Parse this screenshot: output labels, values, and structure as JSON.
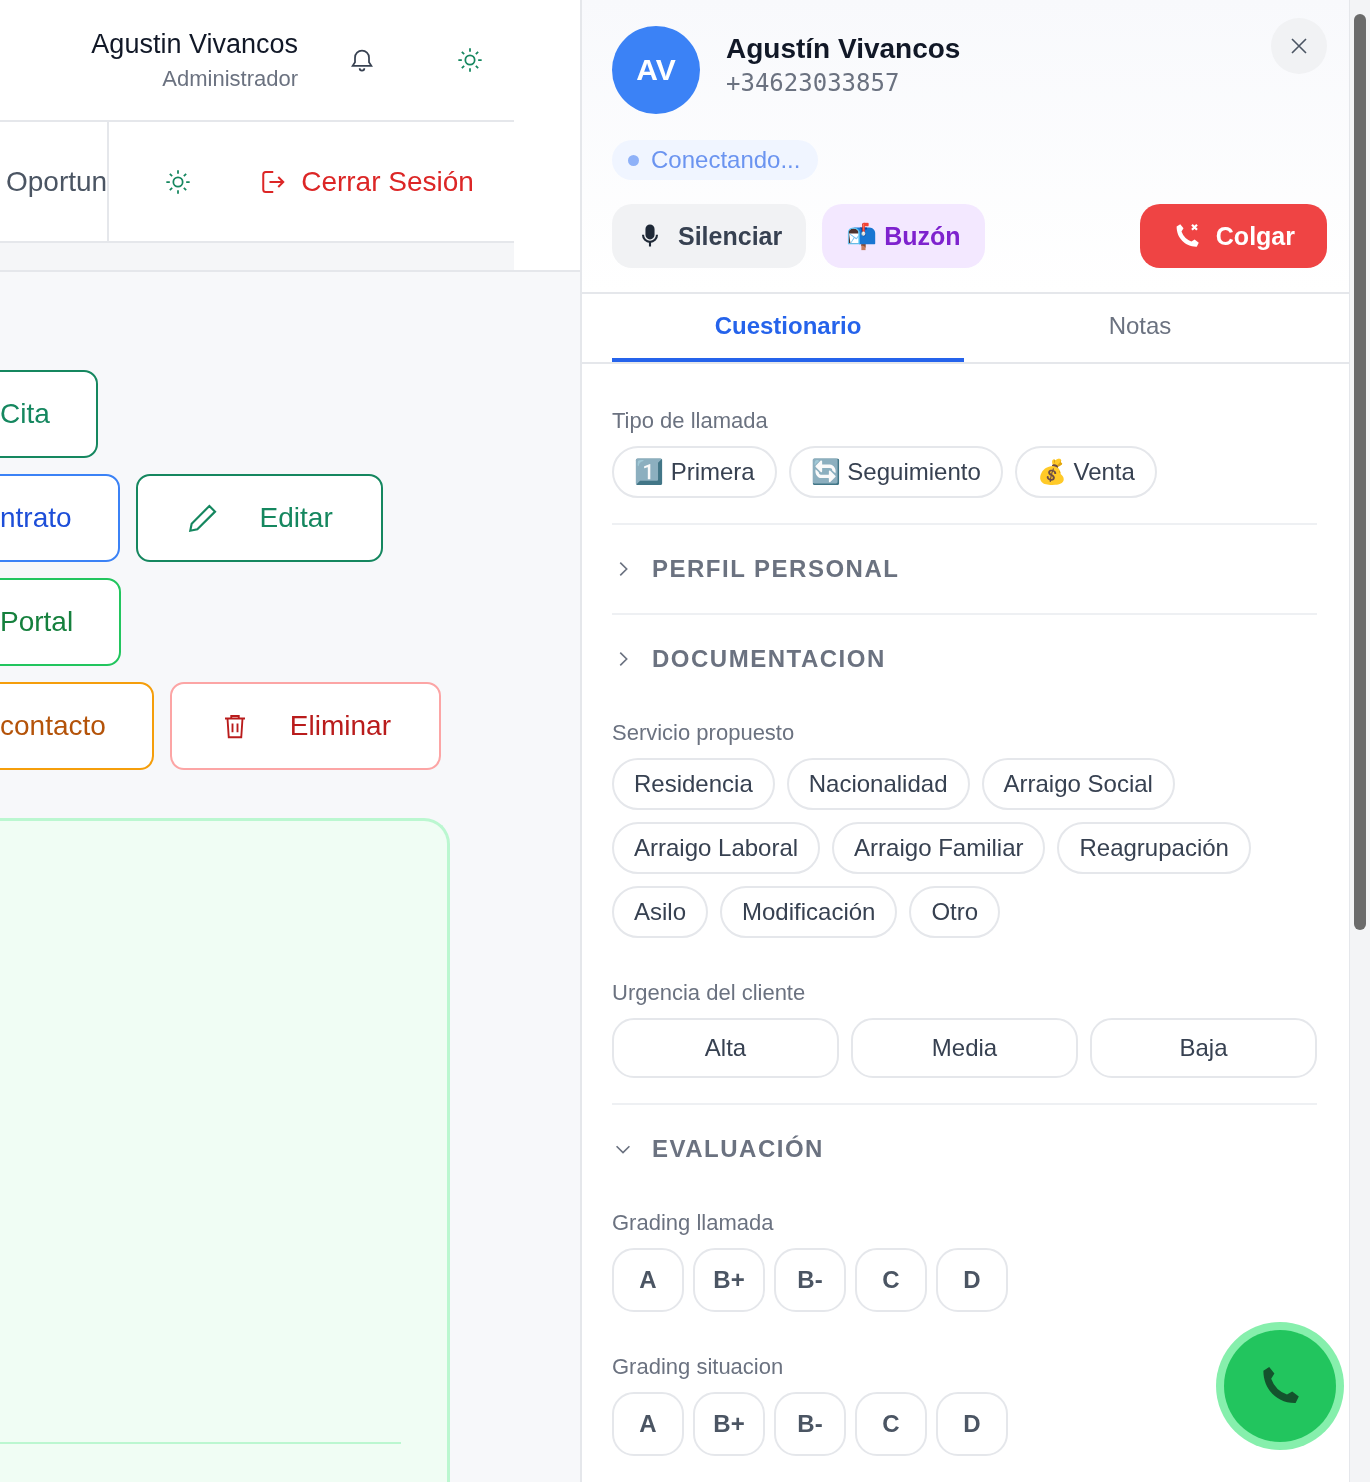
{
  "topbar": {
    "user_name": "Agustin Vivancos",
    "user_role": "Administrador"
  },
  "nav": {
    "items": [
      {
        "label": "Oportun"
      }
    ],
    "logout": "Cerrar Sesión"
  },
  "actions": [
    {
      "buttons": [
        {
          "label": "Cita",
          "kind": "cut",
          "color": "#15875f"
        }
      ]
    },
    {
      "buttons": [
        {
          "label": "ntrato",
          "kind": "cut",
          "color": "#3b82f6"
        },
        {
          "label": "Editar",
          "kind": "pencil",
          "color": "#15875f"
        }
      ]
    },
    {
      "buttons": [
        {
          "label": "Portal",
          "kind": "cut",
          "color": "#22c55e"
        }
      ]
    },
    {
      "buttons": [
        {
          "label": "contacto",
          "kind": "cut",
          "color": "#f59e0b"
        },
        {
          "label": "Eliminar",
          "kind": "trash",
          "color": "#fca5a5"
        }
      ]
    }
  ],
  "call": {
    "initials": "AV",
    "name": "Agustín Vivancos",
    "phone": "+34623033857",
    "status": "Conectando...",
    "controls": [
      {
        "kind": "mute",
        "label": "Silenciar"
      },
      {
        "kind": "voicemail",
        "emoji": "📬",
        "label": "Buzón"
      },
      {
        "kind": "hangup",
        "label": "Colgar"
      }
    ]
  },
  "tabs": [
    {
      "label": "Cuestionario",
      "selected": true
    },
    {
      "label": "Notas",
      "selected": false
    }
  ],
  "questionnaire": [
    {
      "kind": "chips",
      "label": "Tipo de llamada",
      "options": [
        {
          "emoji": "1️⃣",
          "label": "Primera",
          "selected": false
        },
        {
          "emoji": "🔄",
          "label": "Seguimiento",
          "selected": false
        },
        {
          "emoji": "💰",
          "label": "Venta",
          "selected": false
        }
      ]
    },
    {
      "kind": "section",
      "title": "PERFIL PERSONAL",
      "expanded": false
    },
    {
      "kind": "section",
      "title": "DOCUMENTACION",
      "expanded": false
    },
    {
      "kind": "chips",
      "label": "Servicio propuesto",
      "options": [
        {
          "label": "Residencia",
          "selected": false
        },
        {
          "label": "Nacionalidad",
          "selected": false
        },
        {
          "label": "Arraigo Social",
          "selected": false
        },
        {
          "label": "Arraigo Laboral",
          "selected": false
        },
        {
          "label": "Arraigo Familiar",
          "selected": false
        },
        {
          "label": "Reagrupación",
          "selected": false
        },
        {
          "label": "Asilo",
          "selected": false
        },
        {
          "label": "Modificación",
          "selected": false
        },
        {
          "label": "Otro",
          "selected": false
        }
      ]
    },
    {
      "kind": "segmented",
      "label": "Urgencia del cliente",
      "options": [
        {
          "label": "Alta",
          "selected": false
        },
        {
          "label": "Media",
          "selected": false
        },
        {
          "label": "Baja",
          "selected": false
        }
      ]
    },
    {
      "kind": "section",
      "title": "EVALUACIÓN",
      "expanded": true
    },
    {
      "kind": "grades",
      "label": "Grading llamada",
      "options": [
        {
          "label": "A",
          "selected": false
        },
        {
          "label": "B+",
          "selected": false
        },
        {
          "label": "B-",
          "selected": false
        },
        {
          "label": "C",
          "selected": false
        },
        {
          "label": "D",
          "selected": false
        }
      ]
    },
    {
      "kind": "grades",
      "label": "Grading situacion",
      "options": [
        {
          "label": "A",
          "selected": false
        },
        {
          "label": "B+",
          "selected": false
        },
        {
          "label": "B-",
          "selected": false
        },
        {
          "label": "C",
          "selected": false
        },
        {
          "label": "D",
          "selected": false
        }
      ]
    }
  ]
}
